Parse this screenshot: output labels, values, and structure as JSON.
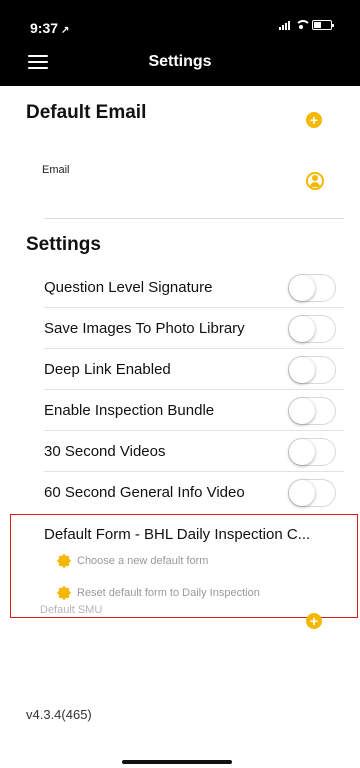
{
  "status_bar": {
    "time": "9:37",
    "location_arrow": "↗"
  },
  "header": {
    "title": "Settings",
    "menu_icon": "hamburger-menu-icon"
  },
  "default_email": {
    "title": "Default Email",
    "add_icon": "+",
    "email_label": "Email",
    "contact_icon": "person-icon"
  },
  "settings": {
    "title": "Settings",
    "items": [
      {
        "label": "Question Level Signature",
        "enabled": false
      },
      {
        "label": "Save Images To Photo Library",
        "enabled": false
      },
      {
        "label": "Deep Link Enabled",
        "enabled": false
      },
      {
        "label": "Enable Inspection Bundle",
        "enabled": false
      },
      {
        "label": "30 Second Videos",
        "enabled": false
      },
      {
        "label": "60 Second General Info Video",
        "enabled": false
      }
    ]
  },
  "default_form": {
    "title": "Default Form - BHL Daily Inspection C...",
    "actions": [
      {
        "label": "Choose a new default form",
        "icon": "gear-icon"
      },
      {
        "label": "Reset default form to Daily Inspection",
        "icon": "gear-icon"
      }
    ],
    "highlight_color": "#d81f1f"
  },
  "default_smu": {
    "label": "Default SMU",
    "add_icon": "+"
  },
  "version": "v4.3.4(465)",
  "colors": {
    "accent": "#f5b800",
    "header_bg": "#000000"
  }
}
